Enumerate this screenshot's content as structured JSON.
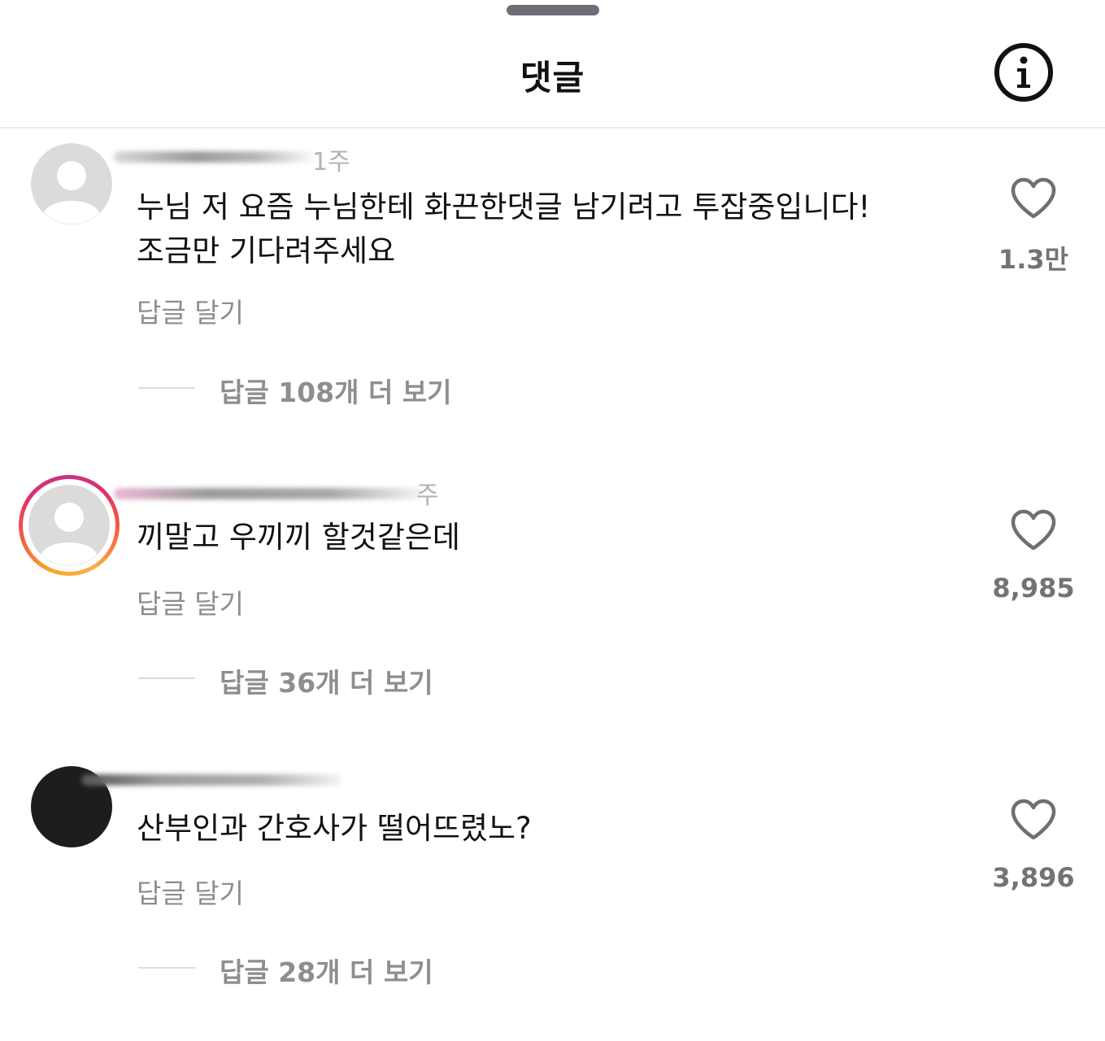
{
  "header": {
    "title": "댓글",
    "info_icon": "info-circle-icon"
  },
  "reply_label": "답글 달기",
  "comments": [
    {
      "time": "1주",
      "text_line1": "누님 저 요즘 누님한테 화끈한댓글 남기려고 투잡중입니다!",
      "text_line2": "조금만 기다려주세요",
      "likes": "1.3만",
      "more_replies": "답글 108개 더 보기",
      "avatar": "default-avatar"
    },
    {
      "time": "주",
      "text_line1": "끼말고 우끼끼 할것같은데",
      "likes": "8,985",
      "more_replies": "답글 36개 더 보기",
      "avatar": "default-avatar-with-story-ring"
    },
    {
      "text_line1": "산부인과 간호사가 떨어뜨렸노?",
      "likes": "3,896",
      "more_replies": "답글 28개 더 보기",
      "avatar": "dark-avatar"
    }
  ],
  "colors": {
    "text": "#111111",
    "secondary": "#8e8e8e",
    "like_count": "#737373",
    "divider": "#ececec"
  }
}
